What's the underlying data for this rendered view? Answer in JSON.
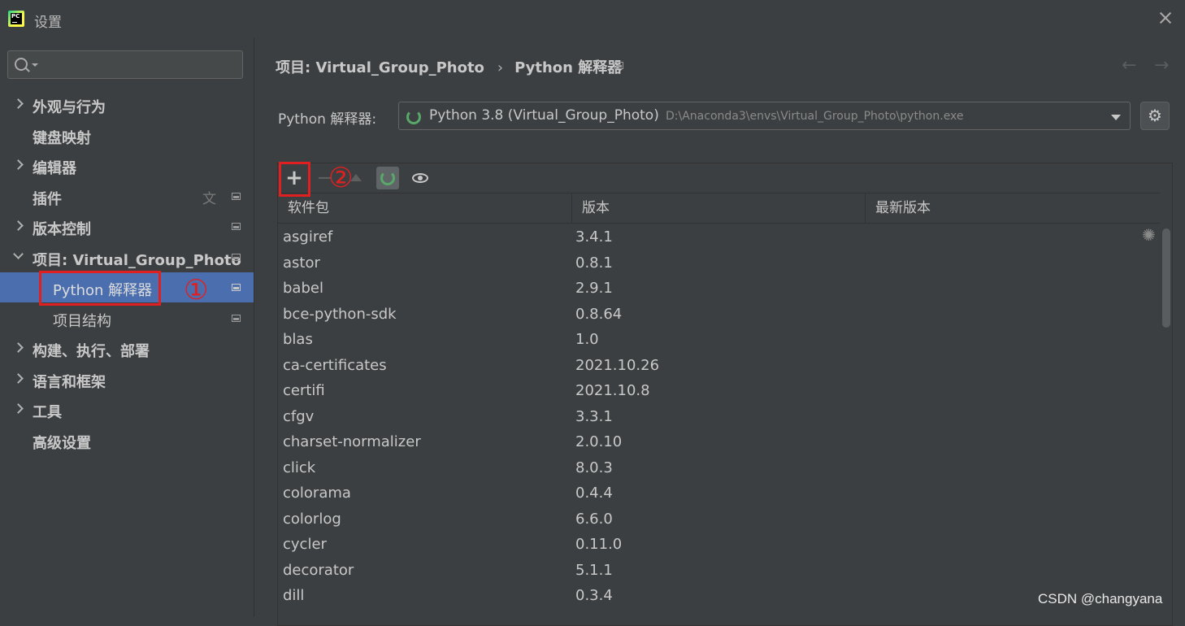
{
  "window": {
    "title": "设置",
    "logo_text": "PC"
  },
  "sidebar": {
    "search_placeholder": "",
    "items": [
      {
        "label": "外观与行为",
        "expandable": true
      },
      {
        "label": "键盘映射",
        "expandable": false
      },
      {
        "label": "编辑器",
        "expandable": true
      },
      {
        "label": "插件",
        "expandable": false
      },
      {
        "label": "版本控制",
        "expandable": true
      },
      {
        "label": "项目: Virtual_Group_Photo",
        "expandable": true,
        "expanded": true
      },
      {
        "label": "Python 解释器",
        "selected": true
      },
      {
        "label": "项目结构"
      },
      {
        "label": "构建、执行、部署",
        "expandable": true
      },
      {
        "label": "语言和框架",
        "expandable": true
      },
      {
        "label": "工具",
        "expandable": true
      },
      {
        "label": "高级设置",
        "expandable": false
      }
    ]
  },
  "annotations": {
    "step1": "①",
    "step2": "②",
    "color": "#e02020"
  },
  "main": {
    "breadcrumb": {
      "project": "项目: Virtual_Group_Photo",
      "separator": "›",
      "page": "Python 解释器"
    },
    "nav": {
      "back": "←",
      "forward": "→"
    },
    "interpreter": {
      "label": "Python 解释器:",
      "name": "Python 3.8 (Virtual_Group_Photo)",
      "path": "D:\\Anaconda3\\envs\\Virtual_Group_Photo\\python.exe"
    },
    "toolbar": {
      "add": "+",
      "remove": "−"
    },
    "table": {
      "columns": [
        "软件包",
        "版本",
        "最新版本"
      ],
      "rows": [
        {
          "package": "asgiref",
          "version": "3.4.1"
        },
        {
          "package": "astor",
          "version": "0.8.1"
        },
        {
          "package": "babel",
          "version": "2.9.1"
        },
        {
          "package": "bce-python-sdk",
          "version": "0.8.64"
        },
        {
          "package": "blas",
          "version": "1.0"
        },
        {
          "package": "ca-certificates",
          "version": "2021.10.26"
        },
        {
          "package": "certifi",
          "version": "2021.10.8"
        },
        {
          "package": "cfgv",
          "version": "3.3.1"
        },
        {
          "package": "charset-normalizer",
          "version": "2.0.10"
        },
        {
          "package": "click",
          "version": "8.0.3"
        },
        {
          "package": "colorama",
          "version": "0.4.4"
        },
        {
          "package": "colorlog",
          "version": "6.6.0"
        },
        {
          "package": "cycler",
          "version": "0.11.0"
        },
        {
          "package": "decorator",
          "version": "5.1.1"
        },
        {
          "package": "dill",
          "version": "0.3.4"
        }
      ]
    }
  },
  "watermark": "CSDN @changyana",
  "colors": {
    "background": "#3c3f41",
    "selection": "#4b6eaf",
    "accent_green": "#59a869",
    "annotation_red": "#e02020"
  }
}
